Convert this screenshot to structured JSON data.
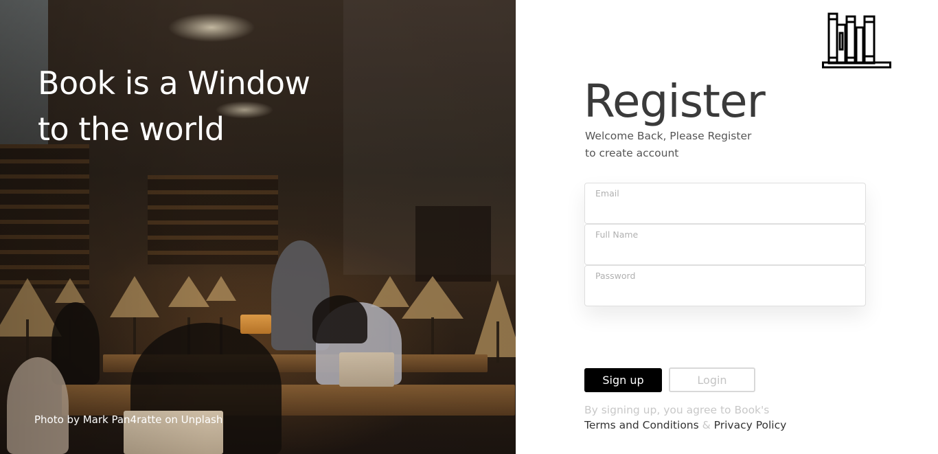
{
  "hero": {
    "title_line1": "Book is a Window",
    "title_line2": "to the world",
    "photo_credit": "Photo by Mark Pan4ratte on Unplash",
    "background_description_color": "#2b221a"
  },
  "logo": {
    "icon": "bookshelf-icon",
    "color": "#000000"
  },
  "register": {
    "title": "Register",
    "subtitle_line1": "Welcome Back, Please Register",
    "subtitle_line2": "to create account"
  },
  "form": {
    "email": {
      "label": "Email",
      "value": ""
    },
    "full_name": {
      "label": "Full Name",
      "value": ""
    },
    "password": {
      "label": "Password",
      "value": ""
    }
  },
  "buttons": {
    "signup_label": "Sign up",
    "login_label": "Login",
    "signup_color": "#000000"
  },
  "terms": {
    "prefix": "By signing up, you agree to Book's",
    "terms_link": "Terms and Conditions",
    "separator": "&",
    "privacy_link": "Privacy Policy"
  }
}
